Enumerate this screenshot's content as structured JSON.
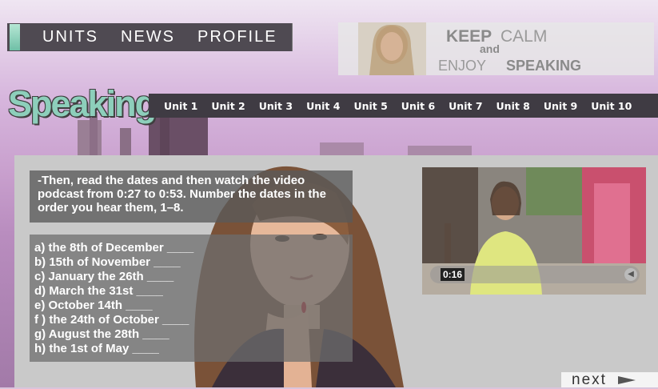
{
  "topnav": {
    "items": [
      "UNITS",
      "NEWS",
      "PROFILE"
    ]
  },
  "banner": {
    "keep": "KEEP",
    "calm": "CALM",
    "and": "and",
    "enjoy": "ENJOY",
    "speaking": "SPEAKING"
  },
  "logo": {
    "text": "Speaking"
  },
  "units": [
    "Unit 1",
    "Unit 2",
    "Unit 3",
    "Unit 4",
    "Unit 5",
    "Unit 6",
    "Unit 7",
    "Unit 8",
    "Unit 9",
    "Unit 10"
  ],
  "instruction": "-Then, read the dates and then watch the video podcast from 0:27 to 0:53. Number the dates in the order you hear them, 1–8.",
  "dates": [
    "a) the 8th of December ____",
    "b) 15th of November ____",
    "c) January the 26th ____",
    "d) March the 31st ____",
    "e) October 14th ____",
    "f ) the 24th of October ____",
    "g) August the 28th ____",
    "h) the 1st of May ____"
  ],
  "video": {
    "time": "0:16"
  },
  "next_label": "next",
  "colors": {
    "accent": "#8dcfbb",
    "nav_bg": "#4f4a52",
    "unit_bar_bg": "#3f3b43"
  }
}
